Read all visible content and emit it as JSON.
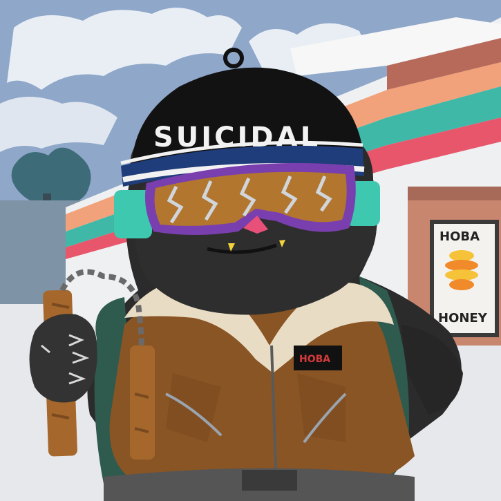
{
  "artwork": {
    "beanie_text": "SUICIDAL",
    "patch_text": "HOBA",
    "poster": {
      "top_text": "HOBA",
      "bottom_text": "HONEY"
    },
    "palette": {
      "sky": "#8fa7c9",
      "cloud": "#e9eef5",
      "building_white": "#eef0f2",
      "stripe_orange": "#f1a27a",
      "stripe_teal": "#3fb8a8",
      "stripe_red": "#e8566b",
      "wall_brick": "#c9866f",
      "fur": "#2b2b2b",
      "beanie": "#121212",
      "band_blue": "#1f3d7a",
      "goggle_frame": "#7a3fae",
      "goggle_lens": "#b2762f",
      "goggle_strap": "#3fc8b0",
      "jacket": "#8a5524",
      "collar": "#e9dcc4",
      "backpack": "#2f5a4e",
      "glove": "#333333",
      "nunchaku": "#a5672c"
    },
    "icons": [
      "nunchaku-icon",
      "honey-hive-icon"
    ]
  }
}
